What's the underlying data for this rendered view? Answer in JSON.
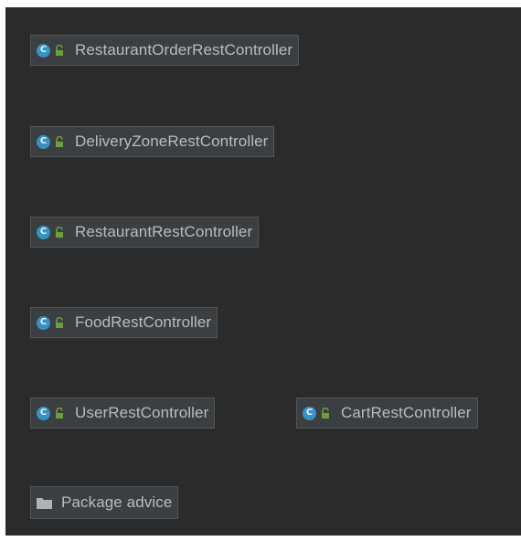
{
  "diagram": {
    "classes": [
      {
        "name": "RestaurantOrderRestController",
        "icon": "class-icon",
        "visibility_icon": "public-lock-icon"
      },
      {
        "name": "DeliveryZoneRestController",
        "icon": "class-icon",
        "visibility_icon": "public-lock-icon"
      },
      {
        "name": "RestaurantRestController",
        "icon": "class-icon",
        "visibility_icon": "public-lock-icon"
      },
      {
        "name": "FoodRestController",
        "icon": "class-icon",
        "visibility_icon": "public-lock-icon"
      },
      {
        "name": "UserRestController",
        "icon": "class-icon",
        "visibility_icon": "public-lock-icon"
      },
      {
        "name": "CartRestController",
        "icon": "class-icon",
        "visibility_icon": "public-lock-icon"
      }
    ],
    "packages": [
      {
        "name": "Package advice",
        "icon": "folder-icon"
      }
    ],
    "class_icon_letter": "C"
  },
  "colors": {
    "background": "#2b2b2b",
    "node_fill": "#3c3f41",
    "node_border": "#515658",
    "text": "#bbbbbb",
    "class_icon": "#3592c4",
    "lock_icon": "#6a9f3b",
    "folder_icon": "#afb1b3"
  }
}
